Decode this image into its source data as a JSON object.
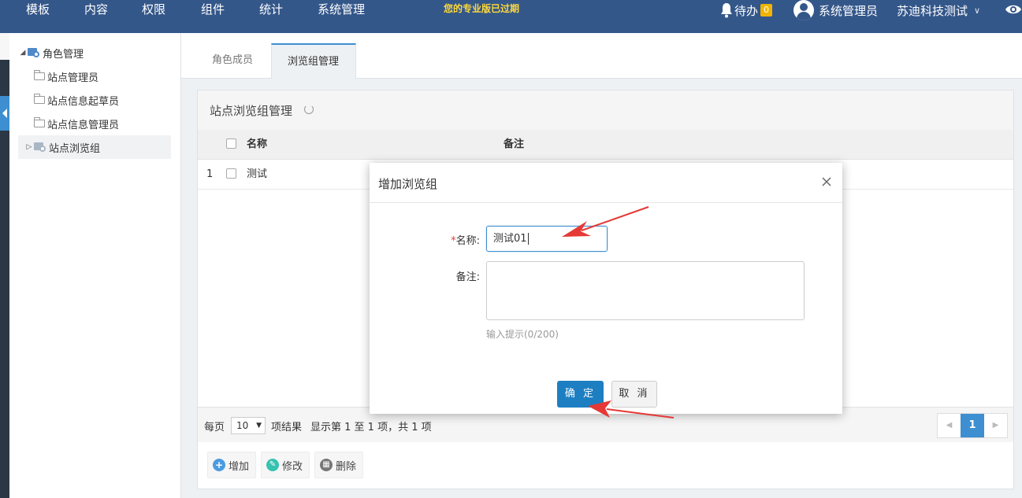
{
  "topbar": {
    "nav": [
      "模板",
      "内容",
      "权限",
      "组件",
      "统计",
      "系统管理"
    ],
    "expired_notice": "您的专业版已过期",
    "todo_label": "待办",
    "todo_count": "0",
    "user_name": "系统管理员",
    "company": "苏迪科技测试"
  },
  "sidebar": {
    "root": "角色管理",
    "items": [
      "站点管理员",
      "站点信息起草员",
      "站点信息管理员",
      "站点浏览组"
    ]
  },
  "tabs": [
    "角色成员",
    "浏览组管理"
  ],
  "panel": {
    "title": "站点浏览组管理",
    "columns": [
      "名称",
      "备注"
    ],
    "rows": [
      {
        "index": "1",
        "name": "测试",
        "remark": ""
      }
    ],
    "footer": {
      "per_page_label": "每页",
      "page_size": "10",
      "suffix": "项结果",
      "summary": "显示第 1 至 1 项，共 1 项",
      "current_page": "1"
    },
    "actions": [
      "增加",
      "修改",
      "删除"
    ]
  },
  "modal": {
    "title": "增加浏览组",
    "name_required_mark": "*",
    "name_label": "名称:",
    "name_value": "测试01",
    "remark_label": "备注:",
    "remark_value": "",
    "hint": "输入提示(0/200)",
    "ok_label": "确 定",
    "cancel_label": "取 消"
  },
  "colors": {
    "topbar": "#34578a",
    "accent": "#3d8fd1",
    "ok": "#1d7fc2",
    "arrow": "#e53935"
  }
}
